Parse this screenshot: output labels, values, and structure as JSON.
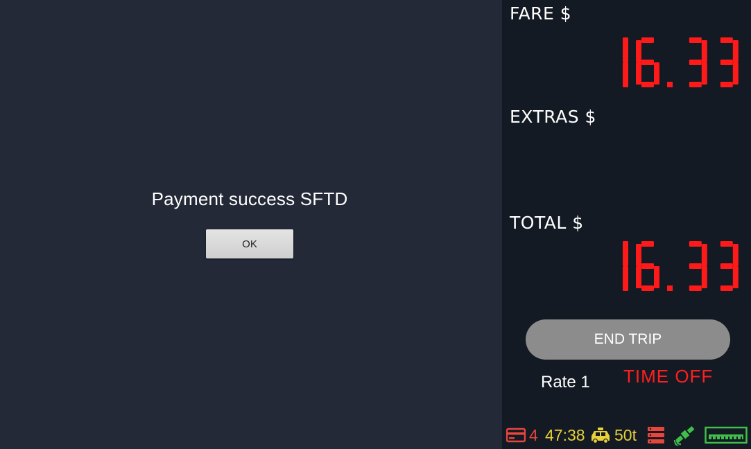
{
  "colors": {
    "dialog_background": "#232936",
    "panel_background": "#141a24",
    "digit_red": "#ff1a1a",
    "status_yellow": "#e8d038",
    "status_red": "#e8463c",
    "status_green": "#3fbf4a",
    "time_off_red": "#ff1f1f"
  },
  "dialog": {
    "message": "Payment success SFTD",
    "ok_label": "OK"
  },
  "meter": {
    "fare_label": "FARE $",
    "fare_value": "16.33",
    "extras_label": "EXTRAS $",
    "extras_value": "",
    "total_label": "TOTAL $",
    "total_value": "16.33",
    "end_trip_label": "END TRIP",
    "rate_label": "Rate 1",
    "time_off_label": "TIME OFF"
  },
  "status_bar": {
    "card_icon": "credit-card-icon",
    "card_count": "4",
    "clock": "47:38",
    "taxi_icon": "taxi-icon",
    "taxi_status": "50t",
    "server_icon": "server-icon",
    "gps_icon": "satellite-icon",
    "printer_icon": "printer-icon"
  }
}
